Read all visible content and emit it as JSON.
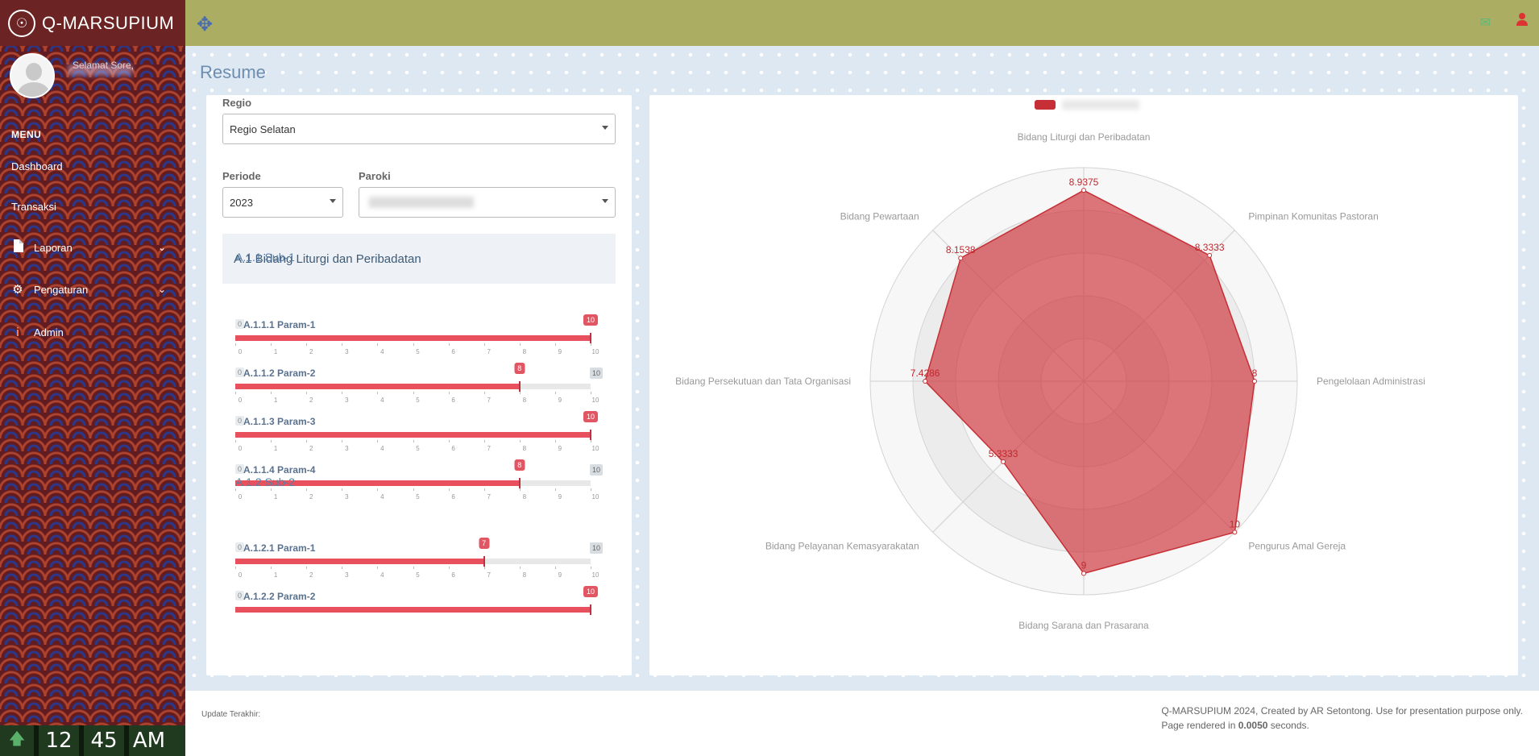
{
  "app": {
    "name": "Q-MARSUPIUM"
  },
  "sidebar": {
    "greeting": "Selamat Sore,",
    "menu_header": "MENU",
    "items": [
      {
        "label": "Dashboard",
        "icon": ""
      },
      {
        "label": "Transaksi",
        "icon": ""
      },
      {
        "label": "Laporan",
        "icon": "file-icon"
      },
      {
        "label": "Pengaturan",
        "icon": "gear-icon"
      },
      {
        "label": "Admin",
        "icon": "info-icon"
      }
    ],
    "clock": {
      "hour": "12",
      "minute": "45",
      "ampm": "AM"
    }
  },
  "page": {
    "title": "Resume"
  },
  "filters": {
    "regio_label": "Regio",
    "regio_value": "Regio Selatan",
    "periode_label": "Periode",
    "periode_value": "2023",
    "paroki_label": "Paroki"
  },
  "section": {
    "title": "A.1 Bidang Liturgi dan Peribadatan",
    "subs": [
      {
        "title": "A.1.1 Sub-1",
        "params": [
          {
            "label": "A.1.1.1 Param-1",
            "value": 10
          },
          {
            "label": "A.1.1.2 Param-2",
            "value": 8
          },
          {
            "label": "A.1.1.3 Param-3",
            "value": 10
          },
          {
            "label": "A.1.1.4 Param-4",
            "value": 8
          }
        ]
      },
      {
        "title": "A.1.2 Sub-2",
        "params": [
          {
            "label": "A.1.2.1 Param-1",
            "value": 7
          },
          {
            "label": "A.1.2.2 Param-2",
            "value": 10
          }
        ]
      }
    ],
    "slider": {
      "min": 0,
      "max": 10
    }
  },
  "chart_data": {
    "type": "radar",
    "categories": [
      "Bidang Liturgi dan Peribadatan",
      "Pimpinan Komunitas Pastoran",
      "Pengelolaan Administrasi",
      "Pengurus Amal Gereja",
      "Bidang Sarana dan Prasarana",
      "Bidang Pelayanan Kemasyarakatan",
      "Bidang Persekutuan dan Tata Organisasi",
      "Bidang Pewartaan"
    ],
    "values": [
      8.9375,
      8.3333,
      8,
      10,
      9,
      5.3333,
      7.4286,
      8.1538
    ],
    "value_labels": [
      "8.9375",
      "8.3333",
      "8",
      "10",
      "9",
      "5.3333",
      "7.4286",
      "8.1538"
    ],
    "rlim": [
      0,
      10
    ],
    "color": "#c62f35"
  },
  "footer": {
    "left": "Update Terakhir:",
    "credit": "Q-MARSUPIUM 2024, Created by AR Setontong. Use for presentation purpose only.",
    "rendered_prefix": "Page rendered in",
    "rendered_value": "0.0050",
    "rendered_suffix": "seconds."
  }
}
